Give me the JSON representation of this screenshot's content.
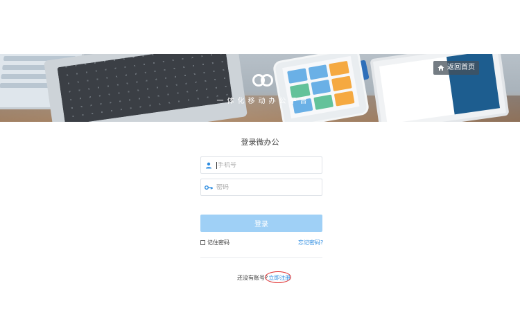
{
  "banner": {
    "slogan": "一体化移动办公平台",
    "home_button_label": "返回首页",
    "icons": {
      "logo": "oo-logo-icon",
      "home": "home-icon"
    }
  },
  "login": {
    "title": "登录微办公",
    "phone_placeholder": "手机号",
    "password_placeholder": "密码",
    "submit_label": "登录",
    "remember_label": "记住密码",
    "remember_checked": false,
    "forgot_label": "忘记密码?",
    "no_account_text": "还没有账号?",
    "register_label": "立即注册",
    "icons": {
      "phone": "user-icon",
      "password": "key-icon"
    }
  },
  "colors": {
    "accent": "#2b8be0",
    "button_bg": "#9fd0f6",
    "annotation": "#e03030"
  }
}
